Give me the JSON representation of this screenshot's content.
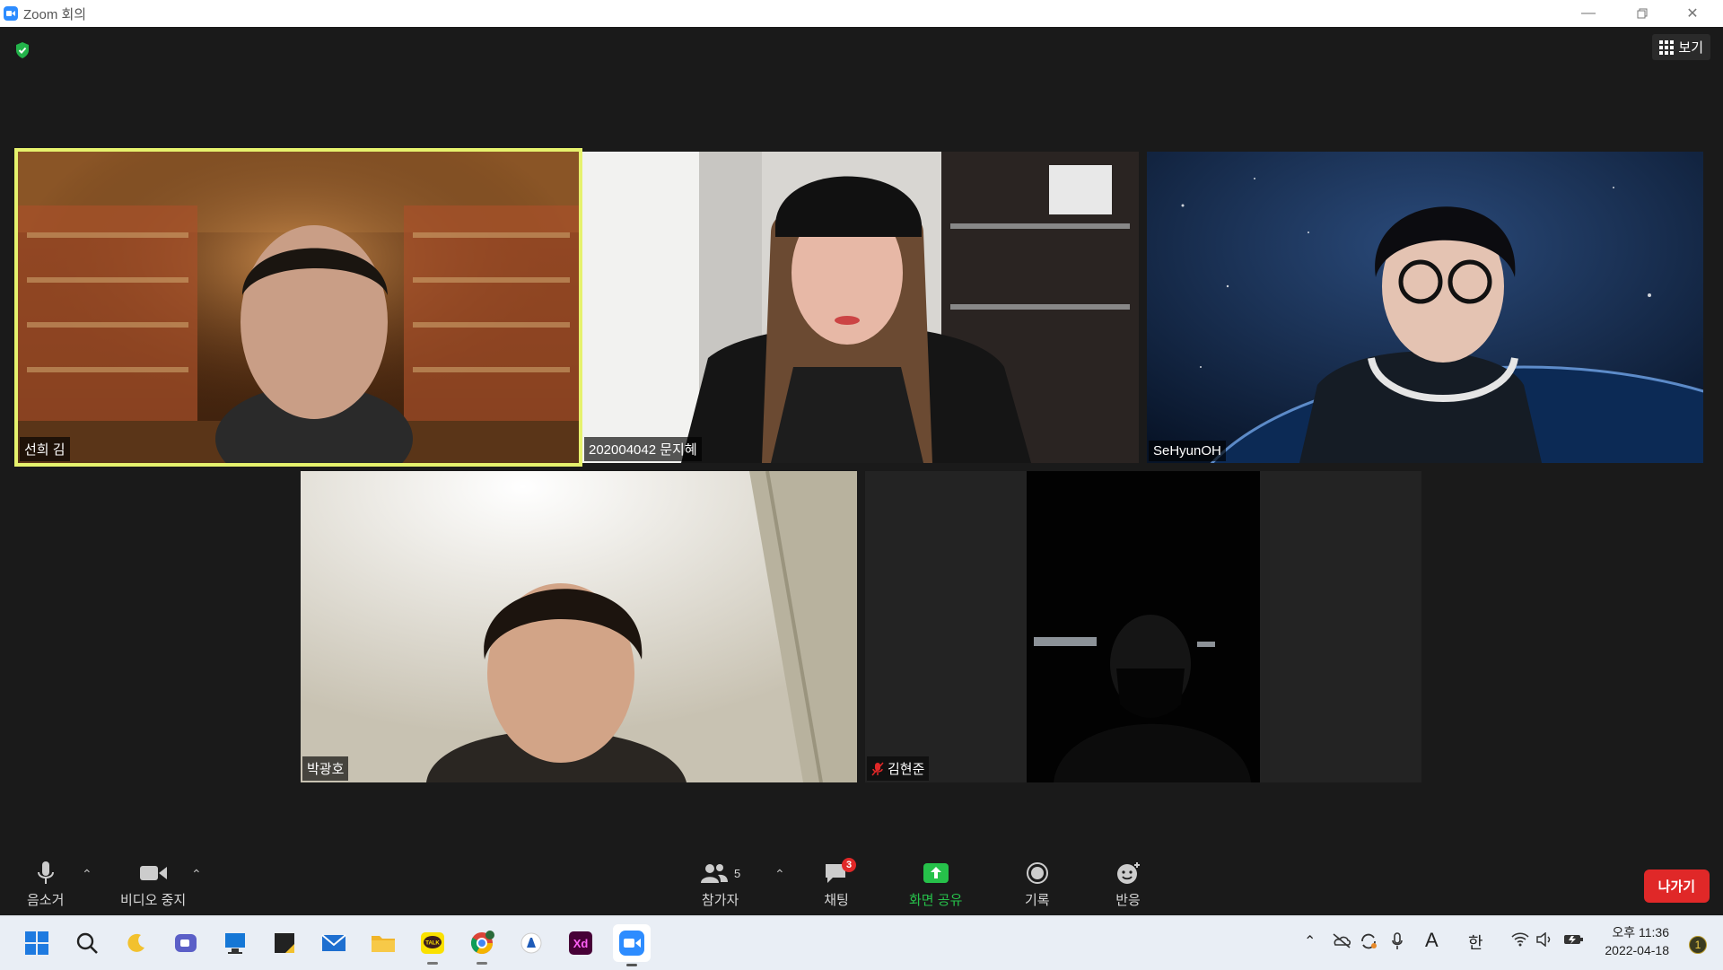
{
  "window": {
    "title": "Zoom 회의"
  },
  "view_button": {
    "label": "보기"
  },
  "participants": [
    {
      "name": "선희 김"
    },
    {
      "name": "202004042 문지혜"
    },
    {
      "name": "SeHyunOH"
    },
    {
      "name": "박광호"
    },
    {
      "name": "김현준"
    }
  ],
  "toolbar": {
    "mute_label": "음소거",
    "video_label": "비디오 중지",
    "participants_label": "참가자",
    "participants_count": "5",
    "chat_label": "채팅",
    "chat_badge": "3",
    "share_label": "화면 공유",
    "record_label": "기록",
    "reactions_label": "반응",
    "leave_label": "나가기"
  },
  "taskbar": {
    "ime_a": "A",
    "ime_han": "한",
    "time": "오후 11:36",
    "date": "2022-04-18",
    "notifications": "1"
  },
  "colors": {
    "active_speaker_border": "#e6f26d",
    "share_green": "#26c14a",
    "leave_red": "#e02828",
    "zoom_blue": "#2d8cff"
  }
}
